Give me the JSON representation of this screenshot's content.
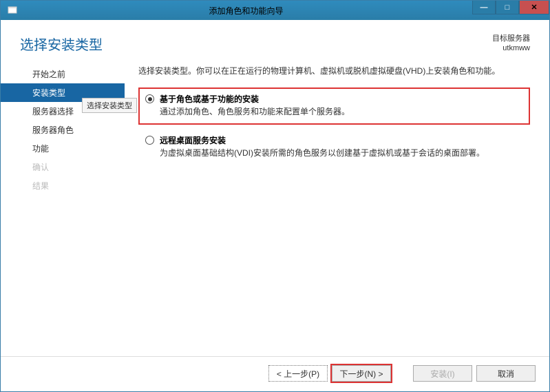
{
  "window": {
    "title": "添加角色和功能向导"
  },
  "header": {
    "page_title": "选择安装类型",
    "target_label": "目标服务器",
    "target_name": "utkmww"
  },
  "sidebar": {
    "items": [
      {
        "label": "开始之前",
        "state": "normal"
      },
      {
        "label": "安装类型",
        "state": "active"
      },
      {
        "label": "服务器选择",
        "state": "normal"
      },
      {
        "label": "服务器角色",
        "state": "normal"
      },
      {
        "label": "功能",
        "state": "normal"
      },
      {
        "label": "确认",
        "state": "disabled"
      },
      {
        "label": "结果",
        "state": "disabled"
      }
    ],
    "tooltip": "选择安装类型"
  },
  "main": {
    "instruction": "选择安装类型。你可以在正在运行的物理计算机、虚拟机或脱机虚拟硬盘(VHD)上安装角色和功能。",
    "options": [
      {
        "title": "基于角色或基于功能的安装",
        "desc": "通过添加角色、角色服务和功能来配置单个服务器。",
        "selected": true,
        "highlighted": true
      },
      {
        "title": "远程桌面服务安装",
        "desc": "为虚拟桌面基础结构(VDI)安装所需的角色服务以创建基于虚拟机或基于会话的桌面部署。",
        "selected": false,
        "highlighted": false
      }
    ]
  },
  "footer": {
    "prev": "< 上一步(P)",
    "next": "下一步(N) >",
    "install": "安装(I)",
    "cancel": "取消"
  }
}
